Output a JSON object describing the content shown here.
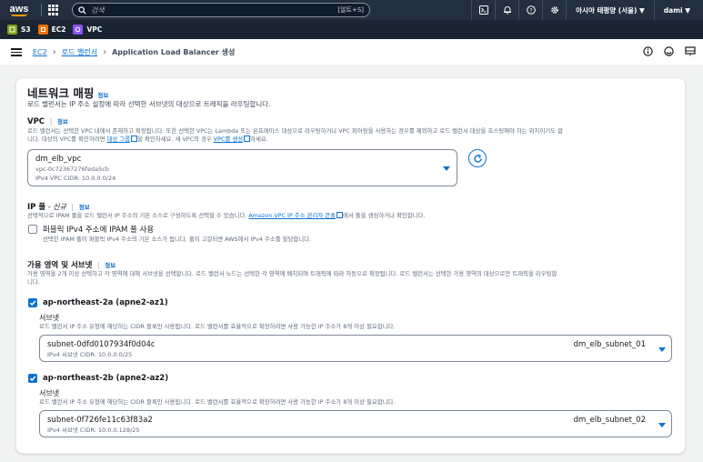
{
  "topnav": {
    "logo": "aws",
    "search_placeholder": "검색",
    "search_shortcut": "[알트+S]",
    "region": "아시아 태평양 (서울) ▼",
    "user": "dami ▼"
  },
  "favorites": [
    {
      "label": "S3",
      "color": "#7aa116"
    },
    {
      "label": "EC2",
      "color": "#ed7100"
    },
    {
      "label": "VPC",
      "color": "#8c4fff"
    }
  ],
  "breadcrumb": {
    "items": [
      "EC2",
      "로드 밸런서"
    ],
    "current": "Application Load Balancer 생성"
  },
  "section": {
    "title": "네트워크 매핑",
    "info": "정보",
    "description": "로드 밸런서는 IP 주소 설정에 따라 선택한 서브넷의 대상으로 트래픽을 라우팅합니다."
  },
  "vpc": {
    "label": "VPC",
    "info": "정보",
    "desc_line1": "로드 밸런서는 선택한 VPC 내에서 존재하고 확장됩니다. 또한 선택한 VPC는 Lambda 또는 온프레미스 대상으로 라우팅하거나 VPC 피어링을 사용하는 경우를 제외하고 로드 밸런서 대상을 호스팅해야 하는 위치이기도 합",
    "desc_line2_a": "니다. 대상의 VPC를 확인하려면 ",
    "desc_link1": "대상 그룹",
    "desc_line2_b": "을 확인하세요. 새 VPC의 경우 ",
    "desc_link2": "VPC를 생성",
    "desc_line2_c": "하세요.",
    "selected_name": "dm_elb_vpc",
    "selected_id": "vpc-0c72367276feda5cb",
    "selected_cidr": "IPv4 VPC CIDR: 10.0.0.0/24"
  },
  "ippool": {
    "label": "IP 풀",
    "tag": " - 신규",
    "info": "정보",
    "desc_a": "선택적으로 IPAM 풀을 로드 밸런서 IP 주소의 기본 소스로 구성하도록 선택할 수 있습니다. ",
    "desc_link": "Amazon VPC IP 주소 관리자 콘솔",
    "desc_b": "에서 풀을 생성하거나 확인합니다.",
    "checkbox_label": "퍼블릭 IPv4 주소에 IPAM 풀 사용",
    "checkbox_desc": "선택한 IPAM 풀이 퍼블릭 IPv4 주소의 기본 소스가 됩니다. 풀이 고갈되면 AWS에서 IPv4 주소를 할당합니다."
  },
  "az": {
    "label": "가용 영역 및 서브넷",
    "info": "정보",
    "desc_line1": "가용 영역을 2개 이상 선택하고 각 영역에 대해 서브넷을 선택합니다. 로드 밸런서 노드는 선택한 각 영역에 배치되며 트래픽에 따라 자동으로 확장됩니다. 로드 밸런서는 선택한 가용 영역의 대상으로만 트래픽을 라우팅합",
    "desc_line2": "니다.",
    "zones": [
      {
        "name": "ap-northeast-2a (apne2-az1)",
        "subnet_label": "서브넷",
        "subnet_desc": "로드 밸런서 IP 주소 유형에 해당하는 CIDR 블록만 사용됩니다. 로드 밸런서를 효율적으로 확장하려면 사용 가능한 IP 주소가 8개 이상 필요합니다.",
        "subnet_id": "subnet-0dfd0107934f0d04c",
        "subnet_cidr": "IPv4 서브넷 CIDR: 10.0.0.0/25",
        "subnet_name": "dm_elb_subnet_01"
      },
      {
        "name": "ap-northeast-2b (apne2-az2)",
        "subnet_label": "서브넷",
        "subnet_desc": "로드 밸런서 IP 주소 유형에 해당하는 CIDR 블록만 사용됩니다. 로드 밸런서를 효율적으로 확장하려면 사용 가능한 IP 주소가 8개 이상 필요합니다.",
        "subnet_id": "subnet-0f726fe11c63f83a2",
        "subnet_cidr": "IPv4 서브넷 CIDR: 10.0.0.128/25",
        "subnet_name": "dm_elb_subnet_02"
      }
    ]
  }
}
